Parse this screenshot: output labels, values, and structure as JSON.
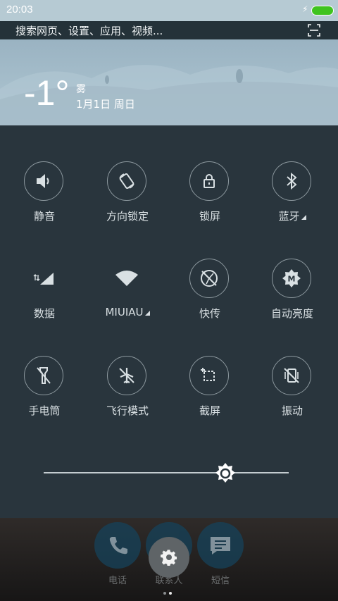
{
  "status_bar": {
    "time": "20:03",
    "charging_icon": "bolt-icon",
    "battery_color": "#3fc31f"
  },
  "search": {
    "placeholder": "搜索网页、设置、应用、视频..."
  },
  "weather": {
    "temperature": "-1°",
    "condition": "雾",
    "date": "1月1日 周日"
  },
  "tiles": [
    {
      "label": "静音",
      "icon": "volume-icon",
      "has_dropdown": false
    },
    {
      "label": "方向锁定",
      "icon": "rotation-lock-icon",
      "has_dropdown": false
    },
    {
      "label": "锁屏",
      "icon": "lock-icon",
      "has_dropdown": false
    },
    {
      "label": "蓝牙",
      "icon": "bluetooth-icon",
      "has_dropdown": true
    },
    {
      "label": "数据",
      "icon": "mobile-data-icon",
      "has_dropdown": false
    },
    {
      "label": "MIUIAU",
      "icon": "wifi-icon",
      "has_dropdown": true
    },
    {
      "label": "快传",
      "icon": "quick-transfer-icon",
      "has_dropdown": false
    },
    {
      "label": "自动亮度",
      "icon": "auto-brightness-icon",
      "has_dropdown": false
    },
    {
      "label": "手电筒",
      "icon": "flashlight-icon",
      "has_dropdown": false
    },
    {
      "label": "飞行模式",
      "icon": "airplane-icon",
      "has_dropdown": false
    },
    {
      "label": "截屏",
      "icon": "screenshot-icon",
      "has_dropdown": false
    },
    {
      "label": "振动",
      "icon": "vibrate-icon",
      "has_dropdown": false
    }
  ],
  "brightness": {
    "level": 0.74
  },
  "dock": [
    {
      "label": "电话",
      "icon": "phone-icon"
    },
    {
      "label": "联系人",
      "icon": "contacts-icon"
    },
    {
      "label": "短信",
      "icon": "message-icon"
    }
  ],
  "settings_button": {
    "icon": "gear-icon"
  },
  "page_indicator": {
    "count": 2,
    "active": 2
  }
}
